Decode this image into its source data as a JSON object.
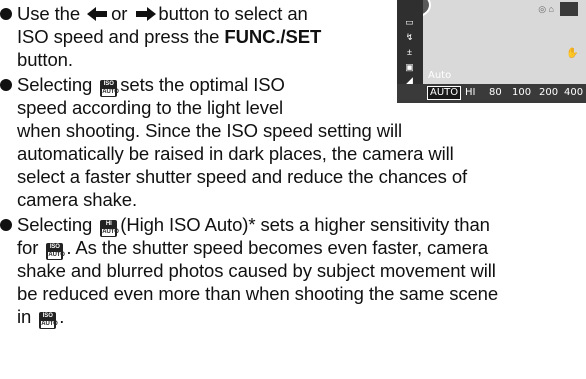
{
  "bullets": [
    {
      "lines": [
        {
          "pre": "Use the",
          "mid": "or",
          "post": "button to select an"
        },
        {
          "text": "ISO speed and press the ",
          "bold": "FUNC./SET"
        },
        {
          "text": "button."
        }
      ]
    },
    {
      "lines": [
        {
          "pre": "Selecting",
          "post": "sets the optimal ISO"
        },
        {
          "text": "speed according to the light level"
        },
        {
          "text": "when shooting. Since the ISO speed setting will"
        },
        {
          "text": "automatically be raised in dark places, the camera will"
        },
        {
          "text": "select a faster shutter speed and reduce the chances of"
        },
        {
          "text": "camera shake."
        }
      ]
    },
    {
      "lines": [
        {
          "pre": "Selecting",
          "post": "(High ISO Auto)* sets a higher sensitivity than"
        },
        {
          "pre": "for",
          "post": ". As the shutter speed becomes even faster, camera"
        },
        {
          "text": "shake and blurred photos caused by subject movement will"
        },
        {
          "text": "be reduced even more than when shooting the same scene"
        },
        {
          "pre": "in",
          "post": "."
        }
      ]
    }
  ],
  "icons": {
    "iso_auto": {
      "top": "ISO",
      "bottom": "AUTO"
    },
    "hi_iso_auto": {
      "top": "HI",
      "bottom": "AUTO"
    }
  },
  "screen": {
    "mode_label": "Auto",
    "iso_options": [
      "AUTO",
      "HI",
      "80",
      "100",
      "200",
      "400"
    ]
  }
}
